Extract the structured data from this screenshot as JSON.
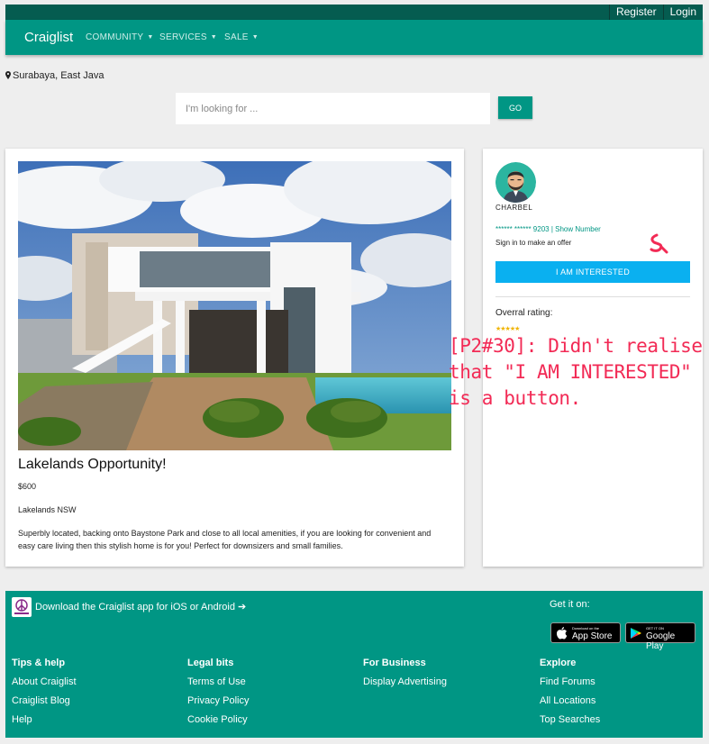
{
  "header": {
    "brand": "Craiglist",
    "nav": [
      "COMMUNITY",
      "SERVICES",
      "SALE"
    ],
    "register_label": "Register",
    "login_label": "Login"
  },
  "location": "Surabaya, East Java",
  "search": {
    "placeholder": "I'm looking for ...",
    "value": "",
    "go_label": "GO"
  },
  "listing": {
    "title": "Lakelands Opportunity!",
    "price": "$600",
    "suburb": "Lakelands NSW",
    "description": "Superbly located, backing onto Baystone Park and close to all local amenities, if you are looking for convenient and easy care living then this stylish home is for you! Perfect for downsizers and small families."
  },
  "seller": {
    "name": "CHARBEL",
    "phone_masked": "****** ****** 9203",
    "show_number_label": "Show Number",
    "signin_text": "Sign in to make an offer",
    "interest_button": "I AM INTERESTED",
    "rating_label": "Overral rating:",
    "rating_stars": 5
  },
  "annotation": "[P2#30]: Didn't realise that \"I AM INTERESTED\" is a button.",
  "footer": {
    "app_text": "Download the Craiglist app for iOS or Android",
    "get_it_on": "Get it on:",
    "app_store": {
      "small": "Download on the",
      "big": "App Store"
    },
    "google_play": {
      "small": "GET IT ON",
      "big": "Google Play"
    },
    "columns": [
      {
        "heading": "Tips & help",
        "links": [
          "About Craiglist",
          "Craiglist Blog",
          "Help"
        ]
      },
      {
        "heading": "Legal bits",
        "links": [
          "Terms of Use",
          "Privacy Policy",
          "Cookie Policy"
        ]
      },
      {
        "heading": "For Business",
        "links": [
          "Display Advertising"
        ]
      },
      {
        "heading": "Explore",
        "links": [
          "Find Forums",
          "All Locations",
          "Top Searches"
        ]
      }
    ]
  },
  "colors": {
    "primary": "#009684",
    "topbar": "#055c50",
    "interest": "#0ab0f0",
    "annotation": "#f22a55"
  }
}
